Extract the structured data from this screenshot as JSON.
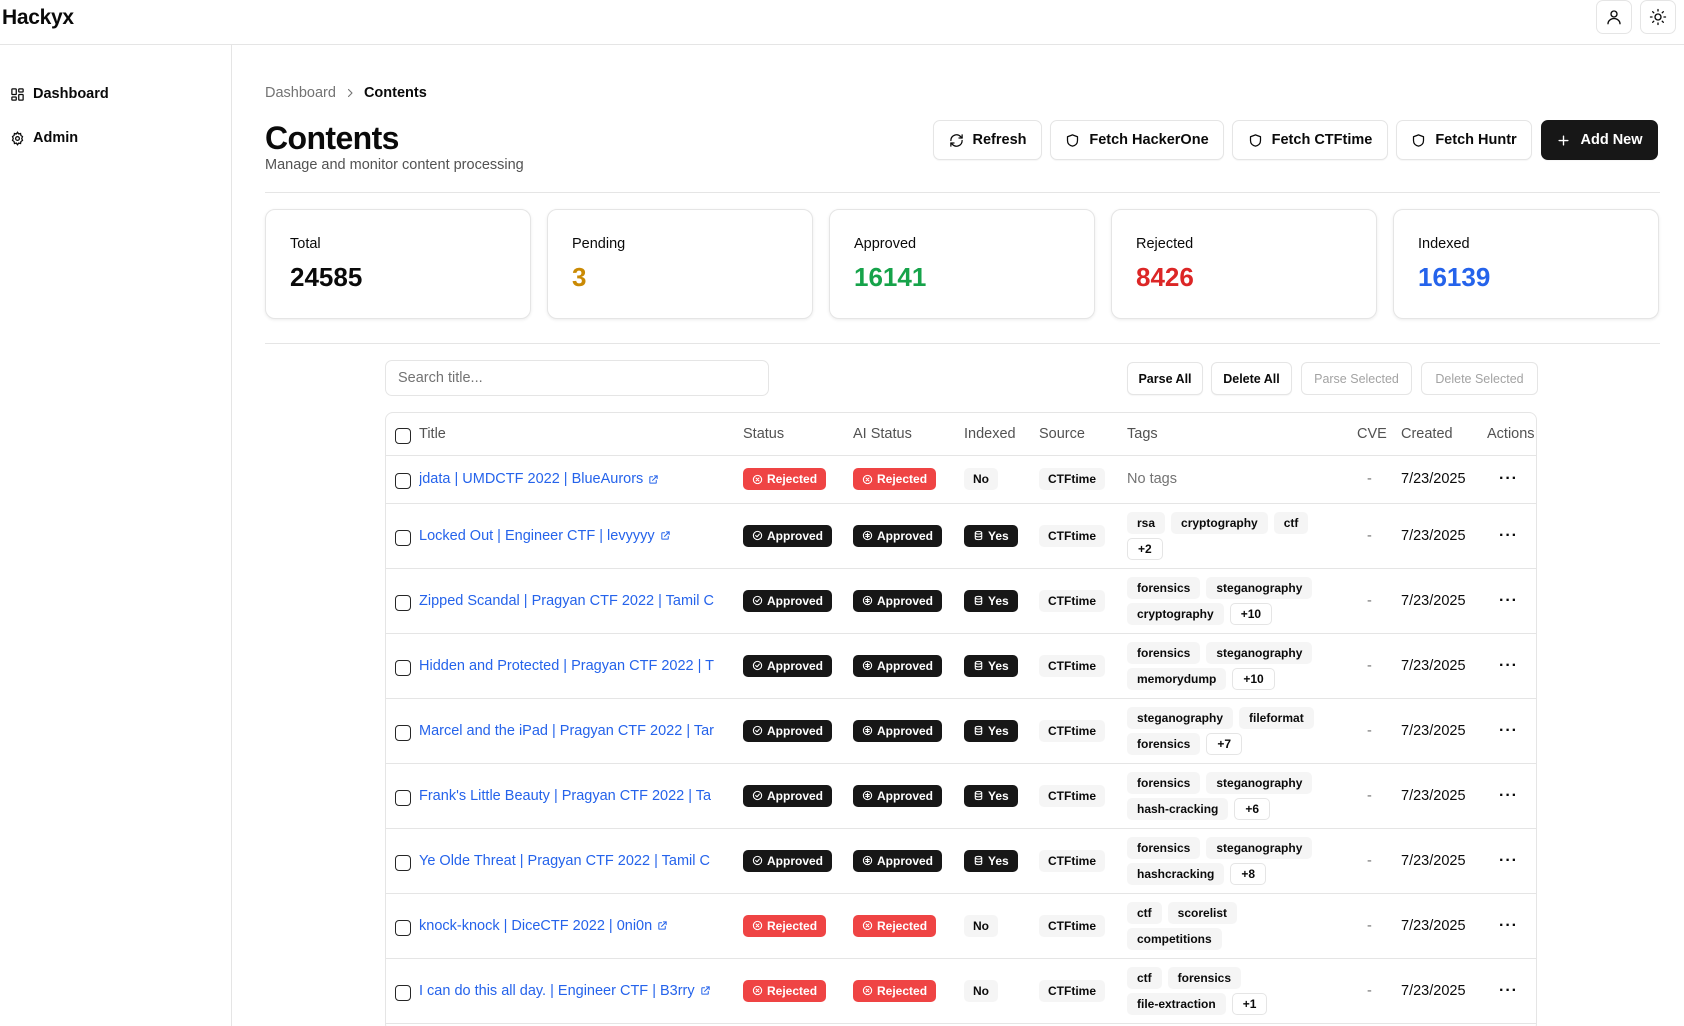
{
  "app": {
    "name": "Hackyx"
  },
  "sidebar": {
    "items": [
      {
        "label": "Dashboard",
        "icon": "dashboard-icon"
      },
      {
        "label": "Admin",
        "icon": "gear-icon"
      }
    ]
  },
  "breadcrumb": {
    "parent": "Dashboard",
    "current": "Contents"
  },
  "header": {
    "title": "Contents",
    "subtitle": "Manage and monitor content processing",
    "buttons": {
      "refresh": "Refresh",
      "fetch_hackerone": "Fetch HackerOne",
      "fetch_ctftime": "Fetch CTFtime",
      "fetch_huntr": "Fetch Huntr",
      "add_new": "Add New"
    }
  },
  "stats": [
    {
      "label": "Total",
      "value": "24585",
      "color": "#0a0a0a"
    },
    {
      "label": "Pending",
      "value": "3",
      "color": "#ca8a04"
    },
    {
      "label": "Approved",
      "value": "16141",
      "color": "#16a34a"
    },
    {
      "label": "Rejected",
      "value": "8426",
      "color": "#dc2626"
    },
    {
      "label": "Indexed",
      "value": "16139",
      "color": "#2563eb"
    }
  ],
  "search": {
    "placeholder": "Search title..."
  },
  "bulk": {
    "parse_all": "Parse All",
    "delete_all": "Delete All",
    "parse_selected": "Parse Selected",
    "delete_selected": "Delete Selected"
  },
  "table": {
    "columns": {
      "title": "Title",
      "status": "Status",
      "ai_status": "AI Status",
      "indexed": "Indexed",
      "source": "Source",
      "tags": "Tags",
      "cve": "CVE",
      "created": "Created",
      "actions": "Actions"
    },
    "rows": [
      {
        "title": "jdata | UMDCTF 2022 | BlueAurors",
        "status": "Rejected",
        "ai_status": "Rejected",
        "indexed": "No",
        "source": "CTFtime",
        "tags": [],
        "no_tags": "No tags",
        "more": "",
        "cve": "-",
        "created": "7/23/2025"
      },
      {
        "title": "Locked Out | Engineer CTF | levyyyy",
        "status": "Approved",
        "ai_status": "Approved",
        "indexed": "Yes",
        "source": "CTFtime",
        "tags": [
          "rsa",
          "cryptography",
          "ctf"
        ],
        "more": "+2",
        "cve": "-",
        "created": "7/23/2025"
      },
      {
        "title": "Zipped Scandal | Pragyan CTF 2022 | Tamil C",
        "status": "Approved",
        "ai_status": "Approved",
        "indexed": "Yes",
        "source": "CTFtime",
        "tags": [
          "forensics",
          "steganography",
          "cryptography"
        ],
        "more": "+10",
        "cve": "-",
        "created": "7/23/2025"
      },
      {
        "title": "Hidden and Protected | Pragyan CTF 2022 | T",
        "status": "Approved",
        "ai_status": "Approved",
        "indexed": "Yes",
        "source": "CTFtime",
        "tags": [
          "forensics",
          "steganography",
          "memorydump"
        ],
        "more": "+10",
        "cve": "-",
        "created": "7/23/2025"
      },
      {
        "title": "Marcel and the iPad | Pragyan CTF 2022 | Tar",
        "status": "Approved",
        "ai_status": "Approved",
        "indexed": "Yes",
        "source": "CTFtime",
        "tags": [
          "steganography",
          "fileformat",
          "forensics"
        ],
        "more": "+7",
        "cve": "-",
        "created": "7/23/2025"
      },
      {
        "title": "Frank's Little Beauty | Pragyan CTF 2022 | Ta",
        "status": "Approved",
        "ai_status": "Approved",
        "indexed": "Yes",
        "source": "CTFtime",
        "tags": [
          "forensics",
          "steganography",
          "hash-cracking"
        ],
        "more": "+6",
        "cve": "-",
        "created": "7/23/2025"
      },
      {
        "title": "Ye Olde Threat | Pragyan CTF 2022 | Tamil C",
        "status": "Approved",
        "ai_status": "Approved",
        "indexed": "Yes",
        "source": "CTFtime",
        "tags": [
          "forensics",
          "steganography",
          "hashcracking"
        ],
        "more": "+8",
        "cve": "-",
        "created": "7/23/2025"
      },
      {
        "title": "knock-knock | DiceCTF 2022 | 0ni0n",
        "status": "Rejected",
        "ai_status": "Rejected",
        "indexed": "No",
        "source": "CTFtime",
        "tags": [
          "ctf",
          "scorelist",
          "competitions"
        ],
        "more": "",
        "cve": "-",
        "created": "7/23/2025"
      },
      {
        "title": "I can do this all day. | Engineer CTF | B3rry",
        "status": "Rejected",
        "ai_status": "Rejected",
        "indexed": "No",
        "source": "CTFtime",
        "tags": [
          "ctf",
          "forensics",
          "file-extraction"
        ],
        "more": "+1",
        "cve": "-",
        "created": "7/23/2025"
      }
    ]
  }
}
